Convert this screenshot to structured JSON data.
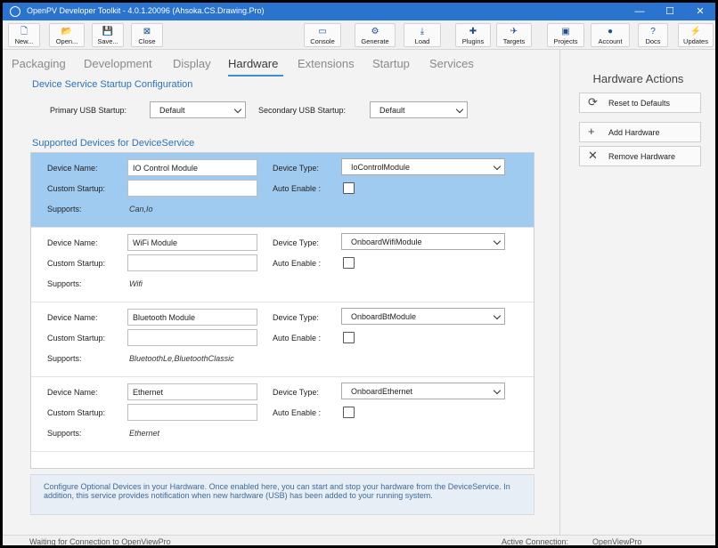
{
  "window": {
    "title": "OpenPV Developer Toolkit - 4.0.1.20096 (Ahsoka.CS.Drawing.Pro)",
    "controls": {
      "minimize": "—",
      "maximize": "☐",
      "close": "✕"
    }
  },
  "toolbar": {
    "left": [
      {
        "label": "New...",
        "icon": "new-file-icon",
        "glyph": "🗋"
      },
      {
        "label": "Open...",
        "icon": "open-folder-icon",
        "glyph": "📂"
      },
      {
        "label": "Save...",
        "icon": "save-icon",
        "glyph": "💾"
      },
      {
        "label": "Close",
        "icon": "close-icon",
        "glyph": "⊠"
      }
    ],
    "right": [
      {
        "label": "Console",
        "icon": "console-icon",
        "glyph": "▭"
      },
      {
        "label": "Generate",
        "icon": "generate-icon",
        "glyph": "⚙"
      },
      {
        "label": "Load",
        "icon": "load-icon",
        "glyph": "⤓"
      },
      {
        "label": "Plugins",
        "icon": "puzzle-icon",
        "glyph": "✚"
      },
      {
        "label": "Targets",
        "icon": "satellite-icon",
        "glyph": "✈"
      },
      {
        "label": "Projects",
        "icon": "briefcase-icon",
        "glyph": "▣"
      },
      {
        "label": "Account",
        "icon": "person-icon",
        "glyph": "●"
      },
      {
        "label": "Docs",
        "icon": "help-icon",
        "glyph": "?"
      },
      {
        "label": "Updates",
        "icon": "lightning-icon",
        "glyph": "⚡"
      }
    ]
  },
  "tabs": [
    "Packaging",
    "Development",
    "Display",
    "Hardware",
    "Extensions",
    "Startup",
    "Services"
  ],
  "active_tab": "Hardware",
  "startup_config": {
    "title": "Device Service Startup Configuration",
    "primary_label": "Primary USB Startup:",
    "primary_value": "Default",
    "secondary_label": "Secondary USB Startup:",
    "secondary_value": "Default"
  },
  "devices_section": {
    "title": "Supported Devices for DeviceService",
    "labels": {
      "device_name": "Device Name:",
      "custom_startup": "Custom Startup:",
      "supports": "Supports:",
      "device_type": "Device Type:",
      "auto_enable": "Auto Enable :"
    },
    "devices": [
      {
        "name": "IO Control Module",
        "custom_startup": "",
        "supports": "Can,Io",
        "type": "IoControlModule",
        "auto_enable": false,
        "selected": true
      },
      {
        "name": "WiFi Module",
        "custom_startup": "",
        "supports": "Wifi",
        "type": "OnboardWifiModule",
        "auto_enable": false,
        "selected": false
      },
      {
        "name": "Bluetooth Module",
        "custom_startup": "",
        "supports": "BluetoothLe,BluetoothClassic",
        "type": "OnboardBtModule",
        "auto_enable": false,
        "selected": false
      },
      {
        "name": "Ethernet",
        "custom_startup": "",
        "supports": "Ethernet",
        "type": "OnboardEthernet",
        "auto_enable": false,
        "selected": false
      }
    ]
  },
  "info_text": "Configure Optional Devices in your Hardware.  Once enabled here, you can start and stop your hardware from the DeviceService.  In addition, this service provides notification when new hardware (USB) has been added to your running system.",
  "sidebar": {
    "title": "Hardware Actions",
    "buttons": [
      {
        "label": "Reset to Defaults",
        "icon": "refresh-icon",
        "glyph": "⟳"
      },
      {
        "label": "Add Hardware",
        "icon": "plus-icon",
        "glyph": "+"
      },
      {
        "label": "Remove Hardware",
        "icon": "x-icon",
        "glyph": "✕"
      }
    ]
  },
  "status": {
    "left": "Waiting for Connection to OpenViewPro",
    "active_label": "Active Connection:",
    "active_value": "OpenViewPro"
  }
}
